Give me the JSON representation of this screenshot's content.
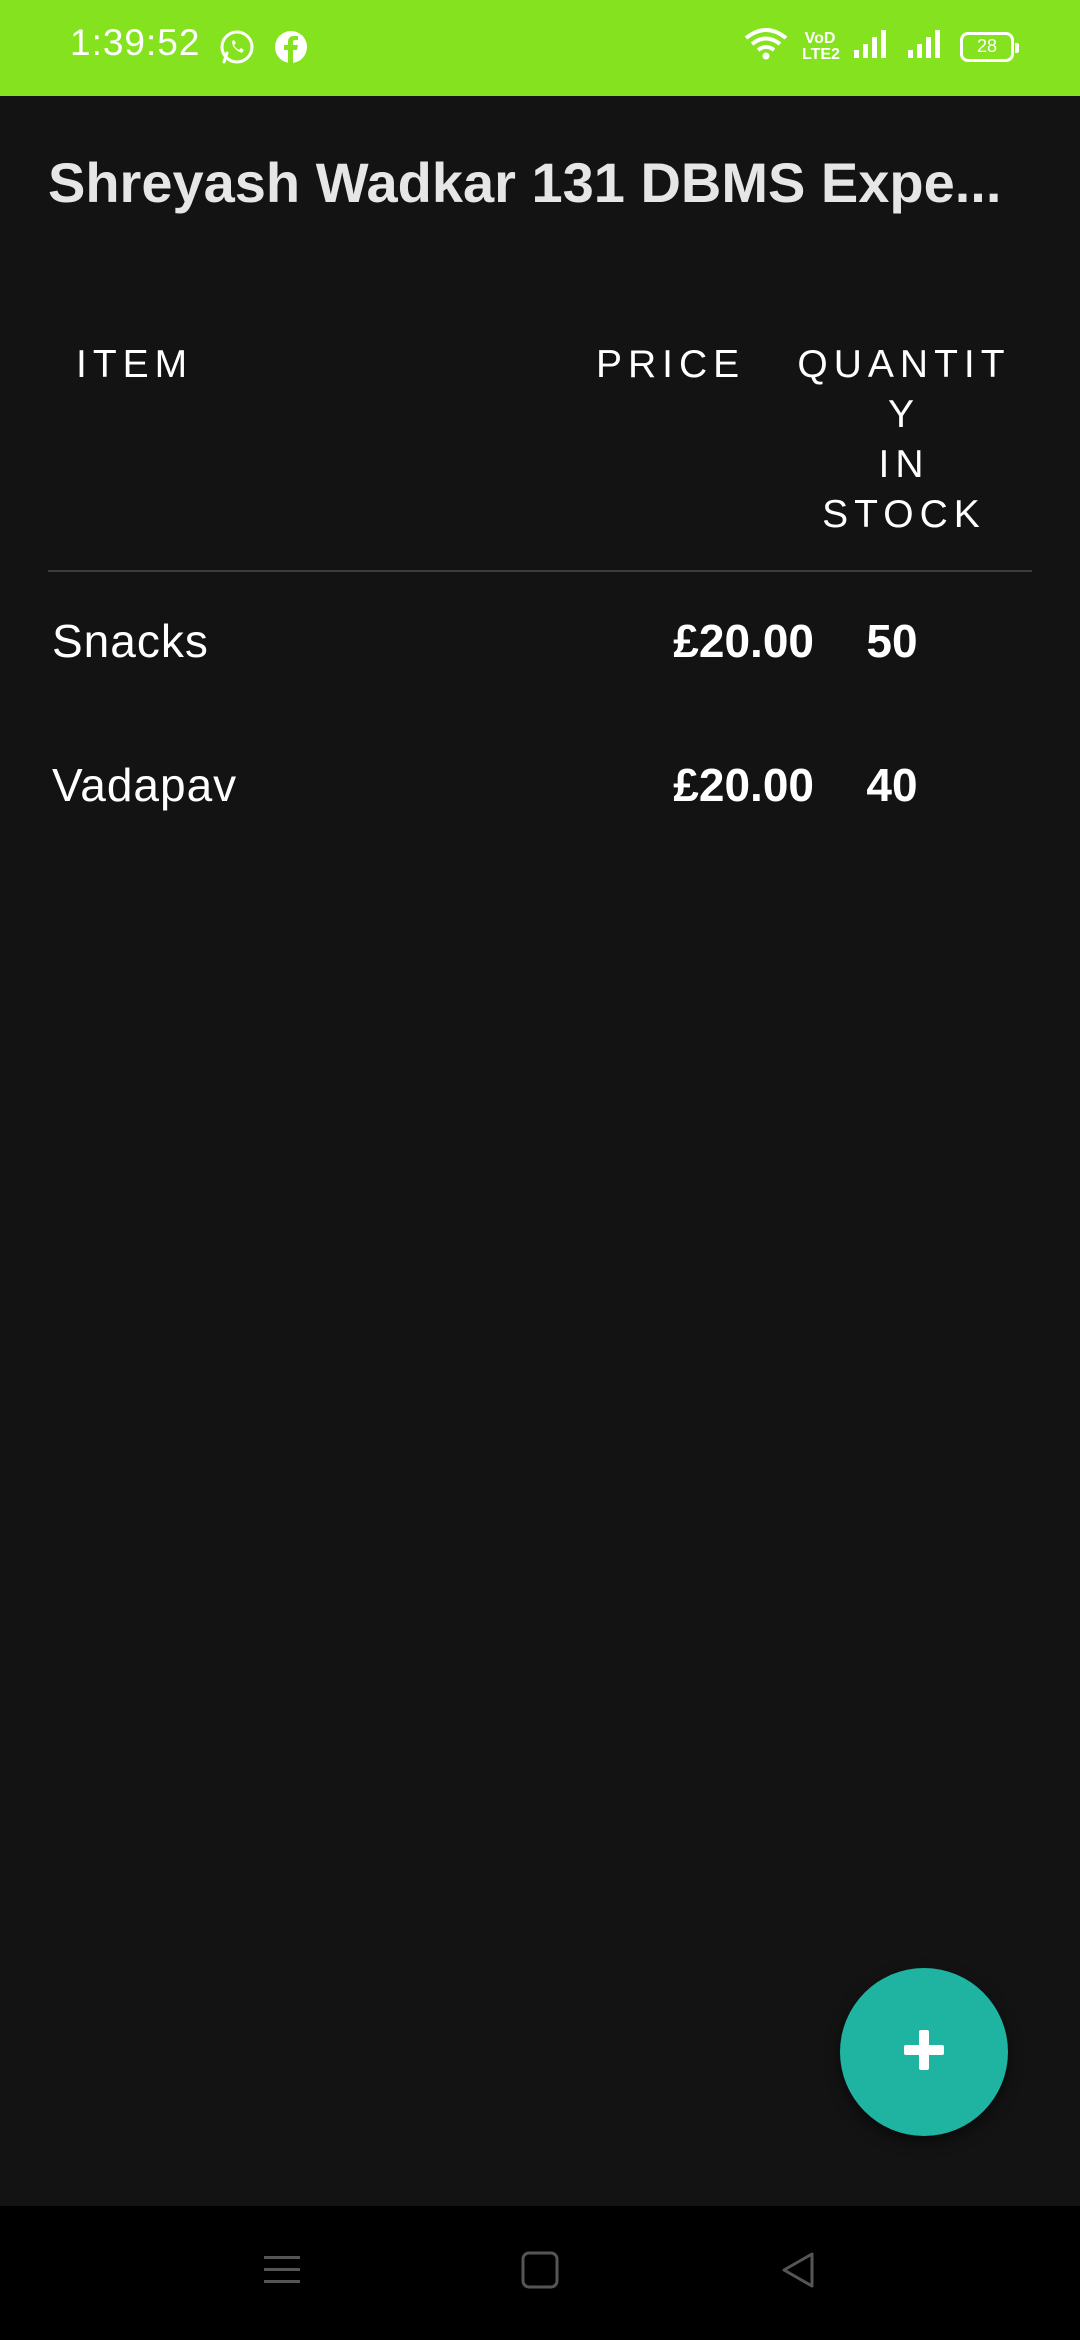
{
  "status_bar": {
    "time": "1:39:52",
    "left_icons": [
      "whatsapp-icon",
      "facebook-icon"
    ],
    "right_icons": [
      "wifi-icon",
      "volte-icon",
      "signal-icon",
      "signal-icon",
      "battery-icon"
    ],
    "volte_text_1": "VoD",
    "volte_text_2": "LTE2",
    "battery_level": "28",
    "background_color": "#84e31e"
  },
  "app_bar": {
    "title": "Shreyash Wadkar 131 DBMS Expe..."
  },
  "table": {
    "headers": {
      "item": "ITEM",
      "price": "PRICE",
      "quantity_line1": "QUANTIT",
      "quantity_line2": "Y",
      "quantity_line3": "IN",
      "quantity_line4": "STOCK"
    },
    "rows": [
      {
        "item": "Snacks",
        "price": "£20.00",
        "quantity": "50"
      },
      {
        "item": "Vadapav",
        "price": "£20.00",
        "quantity": "40"
      }
    ]
  },
  "fab": {
    "icon": "plus-icon",
    "color": "#1fb3a1"
  },
  "nav_bar": {
    "buttons": [
      "menu-icon",
      "home-icon",
      "back-icon"
    ]
  }
}
